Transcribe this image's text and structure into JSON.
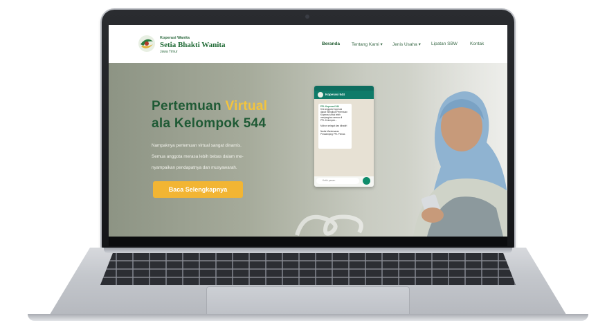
{
  "site": {
    "logo_small": "Koperasi Wanita",
    "logo_name": "Setia Bhakti Wanita",
    "logo_region": "Jawa Timur"
  },
  "nav": [
    {
      "label": "Beranda"
    },
    {
      "label": "Tentang Kami ▾"
    },
    {
      "label": "Jenis Usaha ▾"
    },
    {
      "label": "Lipatan SBW"
    },
    {
      "label": "Kontak"
    }
  ],
  "hero": {
    "title_part1": "Pertemuan ",
    "title_accent": "Virtual",
    "title_line2": "ala Kelompok 544",
    "paragraph_lines": [
      "Nampaknya pertemuan virtual sangat dinamis.",
      "Semua anggota merasa lebih bebas dalam me-",
      "nyampaikan pendapatnya dan musyawarah."
    ],
    "cta_label": "Baca Selengkapnya"
  },
  "phone": {
    "chat_title": "Koperasi 544",
    "bubble_lines": [
      "PPL Koperasi 544",
      "Kini anggota Koperasi",
      "dapat mengikuti Pertemuan",
      "Koperasi untuk lebih",
      "menjangkau semua di",
      "PPL Kelompok...",
      "",
      "Mohon seingat dan dihadiri",
      "",
      "Nadia Mandesaran",
      "Pendamping PPL Primas"
    ],
    "input_placeholder": "Ketik pesan"
  },
  "colors": {
    "brand_green": "#1f5a35",
    "accent_yellow": "#f3c43d",
    "cta_orange": "#f2b533"
  }
}
